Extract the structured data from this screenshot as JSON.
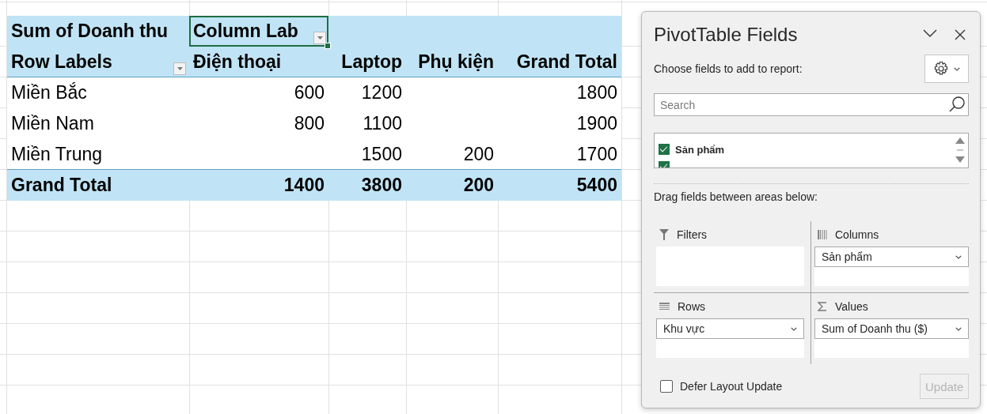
{
  "pivot": {
    "corner_label": "Sum of Doanh thu",
    "column_labels": "Column Lab",
    "row_labels": "Row Labels",
    "columns": [
      "Điện thoại",
      "Laptop",
      "Phụ kiện",
      "Grand Total"
    ],
    "rows": [
      {
        "label": "Miền Bắc",
        "dien_thoai": "600",
        "laptop": "1200",
        "grand_total": "1800"
      },
      {
        "label": "Miền Nam",
        "dien_thoai": "800",
        "laptop": "1100",
        "grand_total": "1900"
      },
      {
        "label": "Miền Trung",
        "laptop": "1500",
        "phu_kien": "200",
        "grand_total": "1700"
      }
    ],
    "grand_total": {
      "label": "Grand Total",
      "dien_thoai": "1400",
      "laptop": "3800",
      "phu_kien": "200",
      "grand_total": "5400"
    }
  },
  "panel": {
    "title": "PivotTable Fields",
    "chooser_label": "Choose fields to add to report:",
    "search": {
      "placeholder": "Search"
    },
    "fields": [
      {
        "label": "Sản phẩm",
        "checked": true
      },
      {
        "checked": true
      }
    ],
    "drag_label": "Drag fields between areas below:",
    "areas": [
      {
        "kind": "filters",
        "label": "Filters"
      },
      {
        "kind": "columns",
        "label": "Columns",
        "items": [
          "Sản phẩm"
        ]
      },
      {
        "kind": "rows",
        "label": "Rows",
        "items": [
          "Khu vực"
        ]
      },
      {
        "kind": "values",
        "label": "Values",
        "items": [
          "Sum of Doanh thu ($)"
        ]
      }
    ],
    "defer": {
      "label": "Defer Layout Update",
      "checked": false
    },
    "update_button": {
      "label": "Update",
      "disabled": true
    }
  }
}
